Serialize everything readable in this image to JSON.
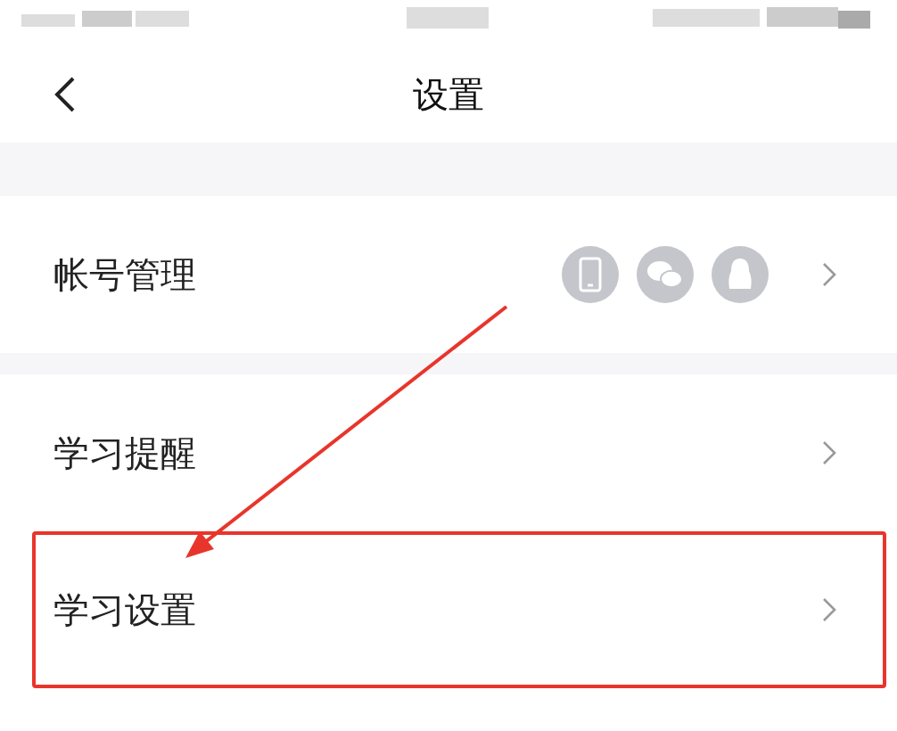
{
  "nav_bar": {
    "title": "设置"
  },
  "groups": [
    {
      "rows": [
        {
          "kind": "accounts",
          "label": "帐号管理",
          "highlighted": false
        }
      ]
    },
    {
      "rows": [
        {
          "kind": "plain",
          "label": "学习提醒",
          "highlighted": false
        },
        {
          "kind": "plain",
          "label": "学习设置",
          "highlighted": true
        }
      ]
    }
  ]
}
